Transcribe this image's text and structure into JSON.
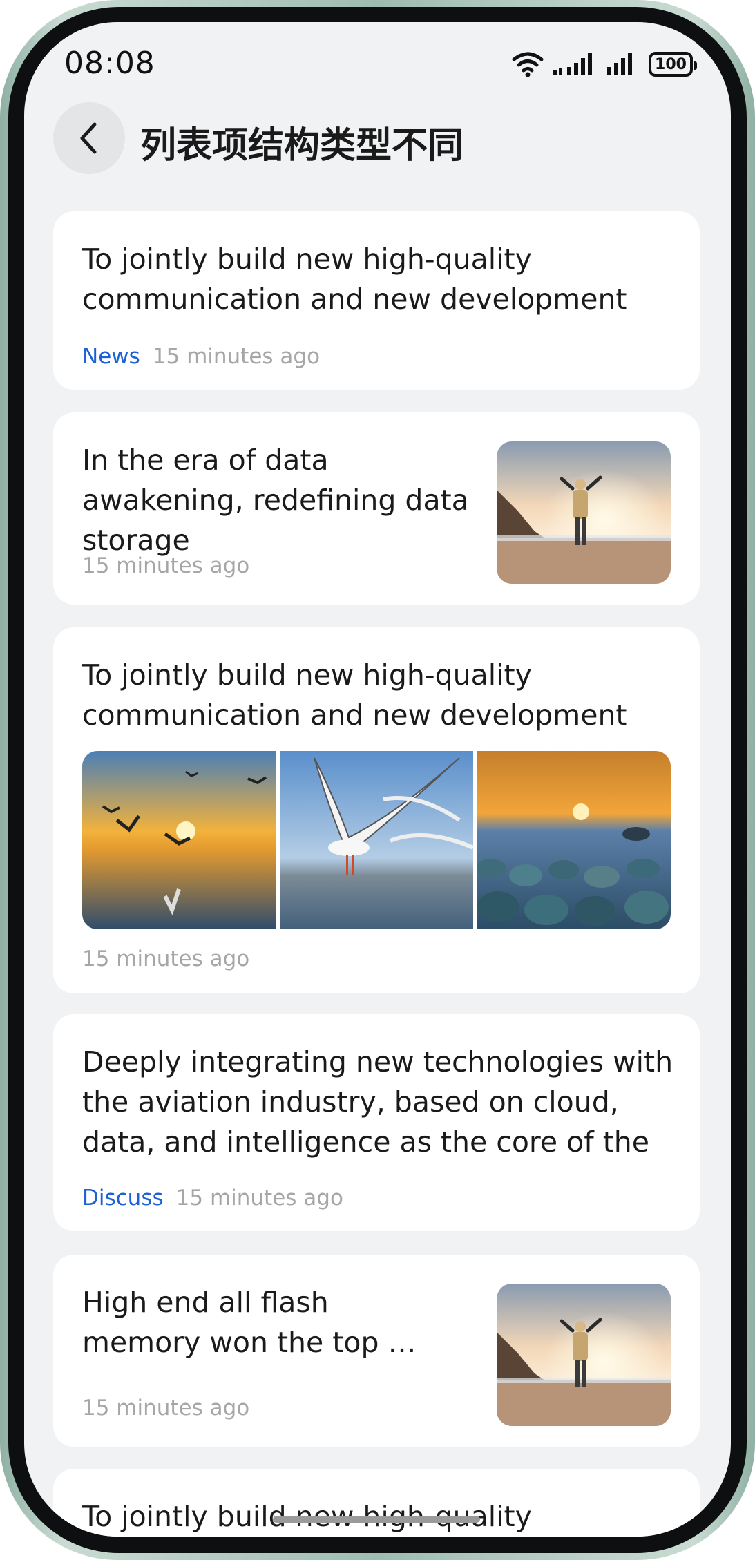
{
  "status_bar": {
    "time": "08:08",
    "battery": "100"
  },
  "header": {
    "title": "列表项结构类型不同"
  },
  "list": {
    "items": [
      {
        "title": "To jointly build new high-quality communication and new development",
        "tag": "News",
        "time": "15 minutes ago"
      },
      {
        "title": "In the era of data awakening, redefining data storage",
        "time": "15 minutes ago",
        "image": "person-beach-sunset"
      },
      {
        "title": "To jointly build new high-quality communication and new development",
        "time": "15 minutes ago",
        "images": [
          "seagulls-sunset",
          "seagulls-sky",
          "pebble-beach-sunset"
        ]
      },
      {
        "title": "Deeply integrating new technologies with the aviation industry, based on cloud, data, and intelligence as the core of the digital …",
        "tag": "Discuss",
        "time": "15 minutes ago"
      },
      {
        "title": "High end all flash memory won the top …",
        "time": "15 minutes ago",
        "image": "person-beach-sunset"
      },
      {
        "title": "To jointly build new high-quality"
      }
    ]
  },
  "colors": {
    "background": "#f1f2f4",
    "card": "#ffffff",
    "tag": "#1b60d6",
    "meta": "#a6a6a6",
    "title": "#1a1a1a"
  },
  "icons": {
    "back": "chevron-left-icon",
    "wifi": "wifi-icon",
    "signal": "signal-icon",
    "battery": "battery-icon"
  }
}
